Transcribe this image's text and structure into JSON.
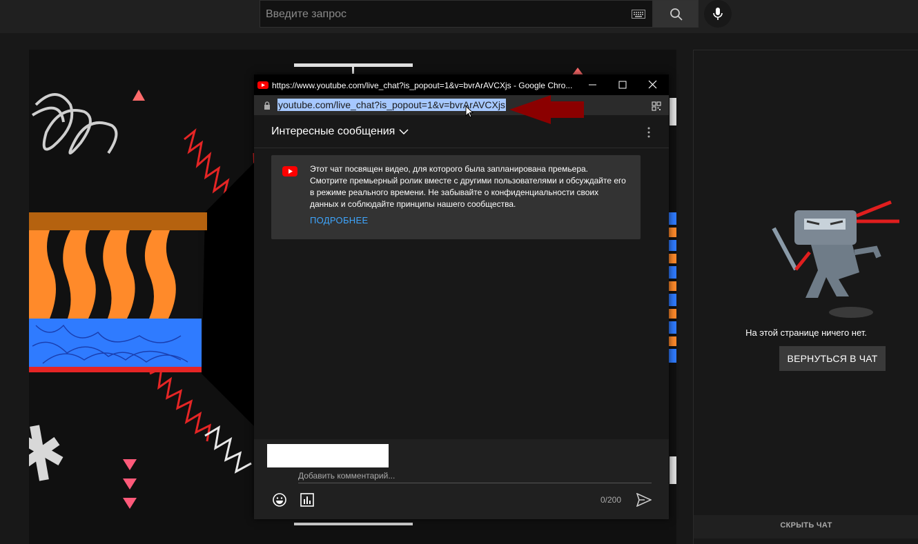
{
  "masthead": {
    "search_placeholder": "Введите запрос"
  },
  "popup": {
    "window_title": "https://www.youtube.com/live_chat?is_popout=1&v=bvrArAVCXjs - Google Chro...",
    "url": "youtube.com/live_chat?is_popout=1&v=bvrArAVCXjs",
    "chat_header": "Интересные сообщения",
    "notice": {
      "text": "Этот чат посвящен видео, для которого была запланирована премьера. Смотрите премьерный ролик вместе с другими пользователями и обсуждайте его в режиме реального времени. Не забывайте о конфиденциальности своих данных и соблюдайте принципы нашего сообщества.",
      "link": "ПОДРОБНЕЕ"
    },
    "composer": {
      "placeholder": "Добавить комментарий...",
      "counter": "0/200"
    }
  },
  "chat_panel": {
    "empty_message": "На этой странице ничего нет.",
    "back_button": "ВЕРНУТЬСЯ В ЧАТ",
    "hide_chat": "СКРЫТЬ ЧАТ"
  },
  "colors": {
    "accent_link": "#3ea6ff",
    "youtube_red": "#ff0000",
    "annotation_arrow": "#8b0000",
    "url_selection": "#a6c8ff"
  },
  "icons": [
    "keyboard-icon",
    "search-icon",
    "mic-icon",
    "youtube-icon",
    "minimize-icon",
    "maximize-icon",
    "close-icon",
    "lock-icon",
    "qr-icon",
    "chevron-down-icon",
    "more-vert-icon",
    "emoji-icon",
    "poll-icon",
    "send-icon"
  ]
}
